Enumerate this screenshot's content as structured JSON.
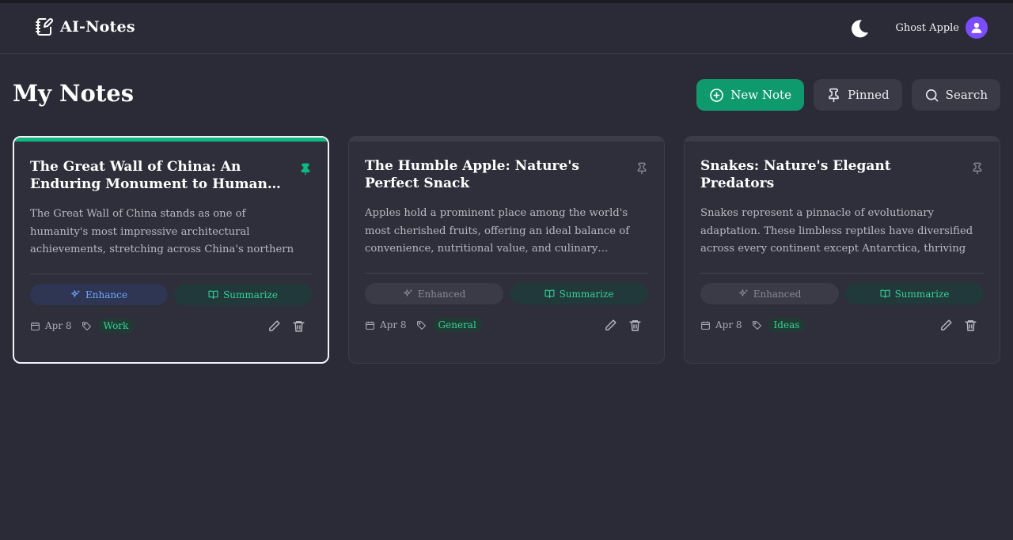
{
  "app": {
    "name": "AI-Notes"
  },
  "user": {
    "name": "Ghost Apple"
  },
  "page": {
    "title": "My Notes"
  },
  "actions": {
    "new_note": "New Note",
    "pinned": "Pinned",
    "search": "Search"
  },
  "colors": {
    "accent": "#10b981",
    "primary_button": "#0f9a6e",
    "background": "#2b2b37",
    "card": "#2f2f3b",
    "avatar": "#7c4dff"
  },
  "notes": [
    {
      "title": "The Great Wall of China: An Enduring Monument to Human…",
      "body": "The Great Wall of China stands as one of humanity's most impressive architectural achievements, stretching across China's northern border like a…",
      "pinned": true,
      "enhance_label": "Enhance",
      "summarize_label": "Summarize",
      "date": "Apr 8",
      "tag": "Work"
    },
    {
      "title": "The Humble Apple: Nature's Perfect Snack",
      "body": "Apples hold a prominent place among the world's most cherished fruits, offering an ideal balance of convenience, nutritional value, and culinary…",
      "pinned": false,
      "enhance_label": "Enhanced",
      "summarize_label": "Summarize",
      "date": "Apr 8",
      "tag": "General"
    },
    {
      "title": "Snakes: Nature's Elegant Predators",
      "body": "Snakes represent a pinnacle of evolutionary adaptation. These limbless reptiles have diversified across every continent except Antarctica, thriving i…",
      "pinned": false,
      "enhance_label": "Enhanced",
      "summarize_label": "Summarize",
      "date": "Apr 8",
      "tag": "Ideas"
    }
  ]
}
